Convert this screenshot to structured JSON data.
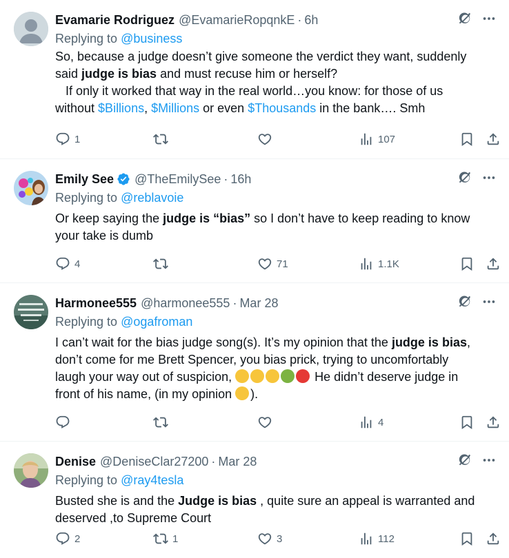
{
  "tweets": [
    {
      "name": "Evamarie Rodriguez",
      "handle": "@EvamarieRopqnkE",
      "time": "6h",
      "replying_prefix": "Replying to ",
      "replying_to": "@business",
      "body": {
        "l1": "So, because a judge doesn’t give someone the verdict they want, suddenly",
        "l2a": "said ",
        "l2b": "judge is bias",
        "l2c": " and must recuse him or herself?",
        "l3": "   If only it worked that way in the real world…you know: for those of us",
        "l4a": "without ",
        "l4b": "$Billions",
        "l4c": ", ",
        "l4d": "$Millions",
        "l4e": " or even ",
        "l4f": "$Thousands",
        "l4g": " in the bank…. Smh"
      },
      "stats": {
        "replies": "1",
        "retweets": "",
        "likes": "",
        "views": "107"
      }
    },
    {
      "name": "Emily See",
      "handle": "@TheEmilySee",
      "time": "16h",
      "replying_prefix": "Replying to ",
      "replying_to": "@reblavoie",
      "body": {
        "l1a": "Or keep saying the ",
        "l1b": "judge is “bias”",
        "l1c": " so I don’t have to keep reading to know",
        "l2": "your take is dumb"
      },
      "stats": {
        "replies": "4",
        "retweets": "",
        "likes": "71",
        "views": "1.1K"
      }
    },
    {
      "name": "Harmonee555",
      "handle": "@harmonee555",
      "time": "Mar 28",
      "replying_prefix": "Replying to ",
      "replying_to": "@ogafroman",
      "body": {
        "l1a": "I can’t wait for the bias judge song(s). It’s my opinion that the ",
        "l1b": "judge is bias",
        "l1c": ",",
        "l2": "don’t come for me Brett Spencer, you bias prick, trying to uncomfortably",
        "l3": "laugh your way out of suspicion, ",
        "l3b": "  He didn’t deserve judge in",
        "l4": "front of his name, (in my opinion ",
        "l4b": ")."
      },
      "stats": {
        "replies": "",
        "retweets": "",
        "likes": "",
        "views": "4"
      }
    },
    {
      "name": "Denise",
      "handle": "@DeniseClar27200",
      "time": "Mar 28",
      "replying_prefix": "Replying to ",
      "replying_to": "@ray4tesla",
      "body": {
        "l1a": "Busted she is and the ",
        "l1b": "Judge is bias",
        "l1c": " , quite sure an appeal is warranted and",
        "l2": "deserved ,to Supreme Court"
      },
      "stats": {
        "replies": "2",
        "retweets": "1",
        "likes": "3",
        "views": "112"
      }
    }
  ],
  "separator": "·",
  "colors": {
    "link": "#1d9bf0",
    "secondary": "#536471",
    "verified": "#1d9bf0"
  },
  "icons": [
    "reply-icon",
    "retweet-icon",
    "like-icon",
    "views-icon",
    "bookmark-icon",
    "share-icon",
    "grok-icon",
    "more-icon",
    "verified-icon"
  ]
}
